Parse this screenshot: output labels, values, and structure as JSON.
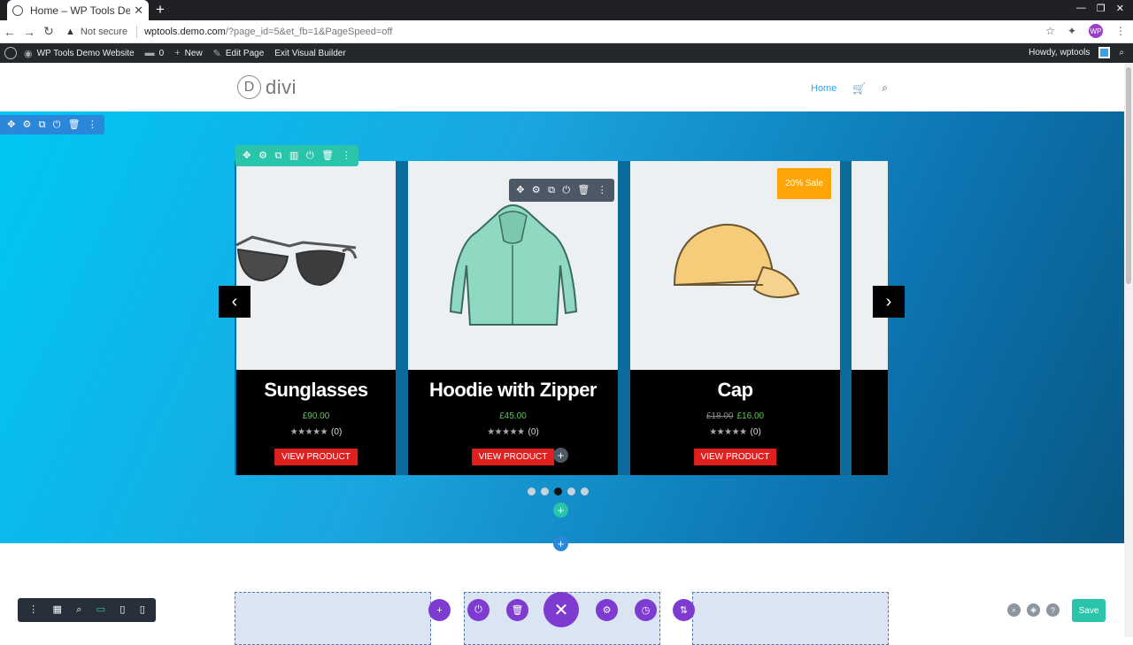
{
  "browser": {
    "tab_title": "Home – WP Tools Demo",
    "not_secure": "Not secure",
    "url_host": "wptools.demo.com",
    "url_path": "/?page_id=5&et_fb=1&PageSpeed=off",
    "profile_initials": "WP"
  },
  "adminbar": {
    "site_name": "WP Tools Demo Website",
    "comments_count": "0",
    "new_label": "New",
    "edit_page_label": "Edit Page",
    "exit_label": "Exit Visual Builder",
    "greeting": "Howdy, wptools"
  },
  "site": {
    "logo_letter": "D",
    "logo_text": "divi",
    "nav_home": "Home"
  },
  "products": [
    {
      "name": "Sunglasses",
      "price": "£90.00",
      "old_price": "",
      "rating_count": "(0)",
      "button": "VIEW PRODUCT"
    },
    {
      "name": "Hoodie with Zipper",
      "price": "£45.00",
      "old_price": "",
      "rating_count": "(0)",
      "button": "VIEW PRODUCT"
    },
    {
      "name": "Cap",
      "price": "£16.00",
      "old_price": "£18.00",
      "rating_count": "(0)",
      "button": "VIEW PRODUCT",
      "badge": "20% Sale"
    }
  ],
  "slider": {
    "dot_count": 5,
    "active_dot": 3
  },
  "builder": {
    "save_label": "Save"
  },
  "colors": {
    "section_blue": "#2b87da",
    "row_green": "#29c4a9",
    "module_gray": "#4c5866",
    "builder_purple": "#7e3bd0",
    "view_product_red": "#e0201f",
    "sale_orange": "#ffa508",
    "price_green": "#5fc55b"
  }
}
